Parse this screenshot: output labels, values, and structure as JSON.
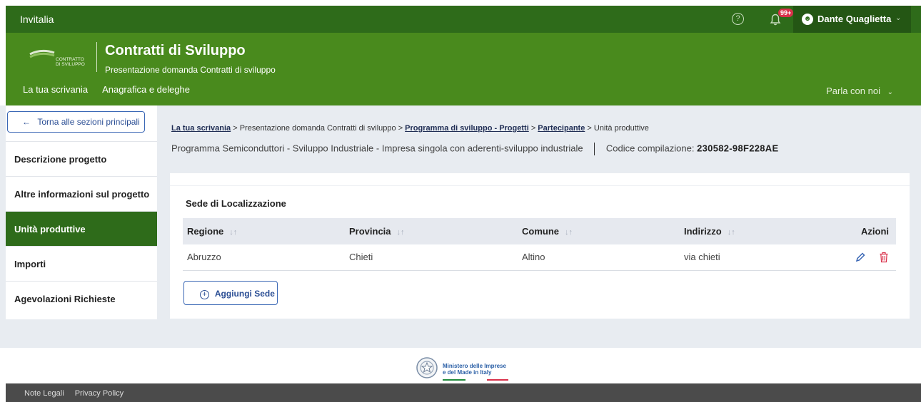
{
  "topbar": {
    "brand": "Invitalia",
    "help_icon": "question-circle-icon",
    "bell_badge": "99+",
    "user_name": "Dante Quaglietta"
  },
  "header": {
    "app_title": "Contratti di Sviluppo",
    "app_subtitle": "Presentazione domanda Contratti di sviluppo",
    "logo_text_1": "CONTRATTO",
    "logo_text_2": "DI SVILUPPO",
    "nav": [
      "La tua scrivania",
      "Anagrafica e deleghe"
    ],
    "chat_label": "Parla con noi"
  },
  "sidebar": {
    "back_label": "Torna alle sezioni principali",
    "items": [
      {
        "label": "Descrizione progetto"
      },
      {
        "label": "Altre informazioni sul progetto"
      },
      {
        "label": "Unità produttive"
      },
      {
        "label": "Importi"
      },
      {
        "label": "Agevolazioni Richieste"
      }
    ],
    "active_index": 2
  },
  "breadcrumb": {
    "items": [
      "La tua scrivania",
      "Presentazione domanda Contratti di sviluppo",
      "Programma di sviluppo - Progetti",
      "Partecipante",
      "Unità produttive"
    ]
  },
  "info": {
    "program": "Programma Semiconduttori - Sviluppo Industriale",
    "type": "Impresa singola con aderenti-sviluppo industriale",
    "code_label": "Codice compilazione:",
    "code_value": "230582-98F228AE"
  },
  "section": {
    "title": "Sede di Localizzazione",
    "columns": [
      "Regione",
      "Provincia",
      "Comune",
      "Indirizzo",
      "Azioni"
    ],
    "rows": [
      {
        "regione": "Abruzzo",
        "provincia": "Chieti",
        "comune": "Altino",
        "indirizzo": "via chieti"
      }
    ],
    "add_label": "Aggiungi Sede"
  },
  "footer": {
    "ministry_line1": "Ministero delle Imprese",
    "ministry_line2": "e del Made in Italy",
    "links": [
      "Note Legali",
      "Privacy Policy"
    ]
  },
  "colors": {
    "topbar": "#2e6b1a",
    "header": "#498a1d",
    "active": "#2e6b1a",
    "link_blue": "#2c4f95",
    "delete_red": "#d9304a"
  }
}
